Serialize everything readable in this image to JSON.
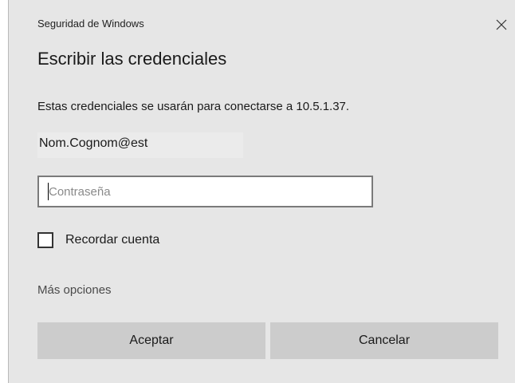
{
  "window": {
    "app_name": "Seguridad de Windows",
    "close_icon": "close-icon"
  },
  "dialog": {
    "heading": "Escribir las credenciales",
    "message": "Estas credenciales se usarán para conectarse a 10.5.1.37.",
    "username": "Nom.Cognom@est",
    "password": {
      "value": "",
      "placeholder": "Contraseña"
    },
    "remember": {
      "label": "Recordar cuenta",
      "checked": false
    },
    "more_options": "Más opciones",
    "buttons": {
      "ok": "Aceptar",
      "cancel": "Cancelar"
    }
  },
  "colors": {
    "background": "#e6e6e6",
    "button": "#cccccc",
    "input_border": "#7a7a7a"
  }
}
